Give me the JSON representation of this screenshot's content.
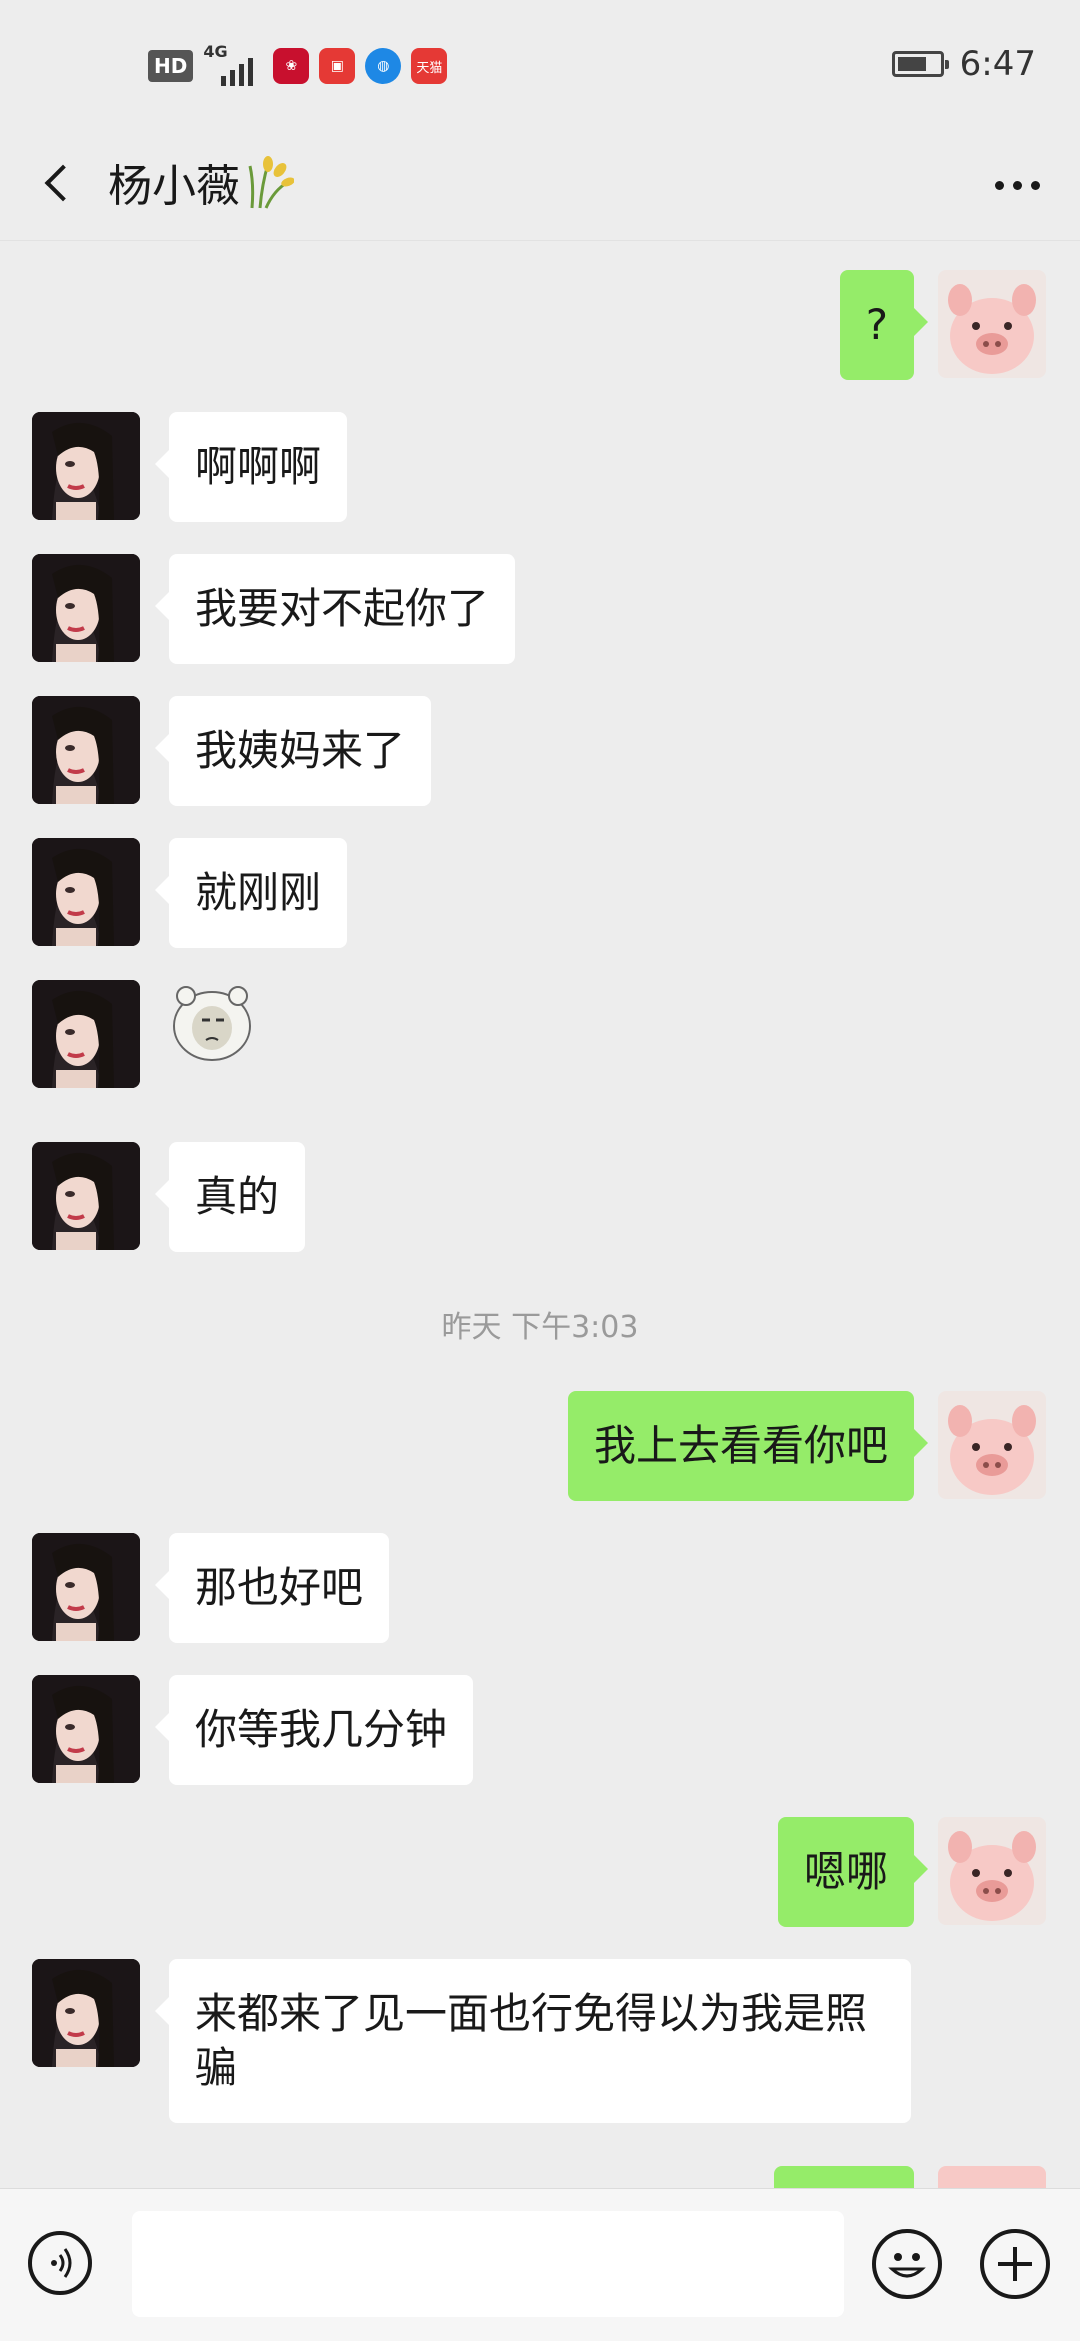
{
  "status_bar": {
    "hd": "HD",
    "network": "4G",
    "signal_bars": 4,
    "apps": [
      {
        "icon": "lotus-app-icon",
        "color": "#c8102e",
        "label": ""
      },
      {
        "icon": "huawei-store-icon",
        "color": "#e53935",
        "label": ""
      },
      {
        "icon": "browser-icon",
        "color": "#1e88e5",
        "label": ""
      },
      {
        "icon": "tmall-icon",
        "color": "#e53935",
        "label": "天猫"
      }
    ],
    "battery_percent": 70,
    "time": "6:47"
  },
  "nav": {
    "title": "杨小薇"
  },
  "timestamp": "昨天 下午3:03",
  "messages": [
    {
      "side": "right",
      "text": "?"
    },
    {
      "side": "left",
      "text": "啊啊啊"
    },
    {
      "side": "left",
      "text": "我要对不起你了"
    },
    {
      "side": "left",
      "text": "我姨妈来了"
    },
    {
      "side": "left",
      "text": "就刚刚"
    },
    {
      "side": "left",
      "sticker": "bear-face-sticker"
    },
    {
      "side": "left",
      "text": "真的"
    },
    {
      "side": "right",
      "text": "我上去看看你吧"
    },
    {
      "side": "left",
      "text": "那也好吧"
    },
    {
      "side": "left",
      "text": "你等我几分钟"
    },
    {
      "side": "right",
      "text": "嗯哪"
    },
    {
      "side": "left",
      "text": "来都来了见一面也行免得以为我是照骗"
    }
  ],
  "colors": {
    "background": "#ededed",
    "sent_bubble": "#95ec69",
    "received_bubble": "#ffffff"
  }
}
